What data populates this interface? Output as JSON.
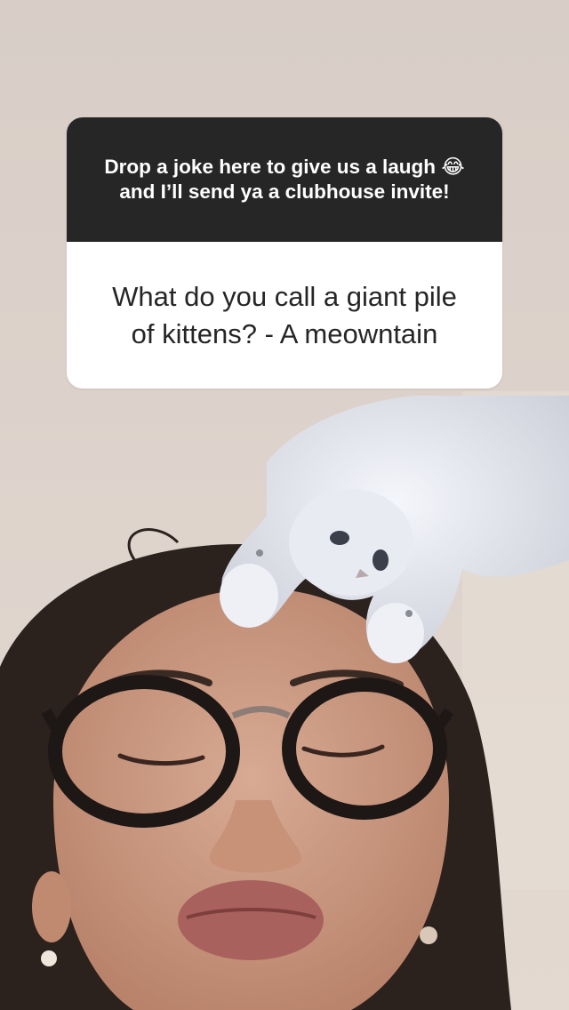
{
  "question_sticker": {
    "prompt_part1": "Drop a joke here to give us a laugh",
    "prompt_emoji": "😂",
    "prompt_part2": "and I’ll send ya a clubhouse invite!",
    "answer": "What do you call a giant pile of kittens? - A meownta​in"
  },
  "colors": {
    "sticker_header_bg": "#262626",
    "sticker_body_bg": "#ffffff",
    "wall": "#d9cfc8"
  }
}
